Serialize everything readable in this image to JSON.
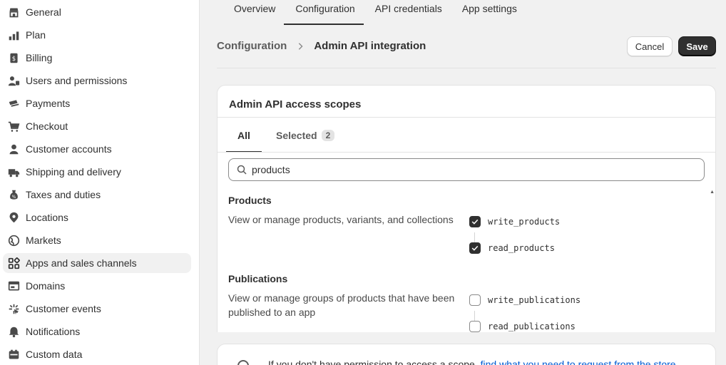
{
  "sidebar": {
    "items": [
      {
        "label": "General",
        "icon": "store-icon"
      },
      {
        "label": "Plan",
        "icon": "plan-icon"
      },
      {
        "label": "Billing",
        "icon": "billing-icon"
      },
      {
        "label": "Users and permissions",
        "icon": "users-icon"
      },
      {
        "label": "Payments",
        "icon": "payments-icon"
      },
      {
        "label": "Checkout",
        "icon": "cart-icon"
      },
      {
        "label": "Customer accounts",
        "icon": "person-icon"
      },
      {
        "label": "Shipping and delivery",
        "icon": "truck-icon"
      },
      {
        "label": "Taxes and duties",
        "icon": "tax-icon"
      },
      {
        "label": "Locations",
        "icon": "location-pin-icon"
      },
      {
        "label": "Markets",
        "icon": "globe-icon"
      },
      {
        "label": "Apps and sales channels",
        "icon": "apps-icon",
        "active": true
      },
      {
        "label": "Domains",
        "icon": "domains-icon"
      },
      {
        "label": "Customer events",
        "icon": "sparkle-icon"
      },
      {
        "label": "Notifications",
        "icon": "bell-icon"
      },
      {
        "label": "Custom data",
        "icon": "custom-data-icon"
      }
    ]
  },
  "tabs": [
    {
      "label": "Overview"
    },
    {
      "label": "Configuration",
      "active": true
    },
    {
      "label": "API credentials"
    },
    {
      "label": "App settings"
    }
  ],
  "breadcrumb": {
    "parent": "Configuration",
    "current": "Admin API integration"
  },
  "actions": {
    "cancel": "Cancel",
    "save": "Save"
  },
  "card": {
    "title": "Admin API access scopes",
    "tab_all": "All",
    "tab_selected": "Selected",
    "selected_count": "2",
    "search": {
      "value": "products"
    },
    "groups": [
      {
        "title": "Products",
        "description": "View or manage products, variants, and collections",
        "scopes": [
          {
            "label": "write_products",
            "checked": true
          },
          {
            "label": "read_products",
            "checked": true
          }
        ]
      },
      {
        "title": "Publications",
        "description": "View or manage groups of products that have been published to an app",
        "scopes": [
          {
            "label": "write_publications",
            "checked": false
          },
          {
            "label": "read_publications",
            "checked": false
          }
        ]
      }
    ]
  },
  "info": {
    "text": "If you don't have permission to access a scope,",
    "link": "find what you need to request from the store"
  },
  "colors": {
    "primary_button": "#303030",
    "link": "#005bd3",
    "page_bg": "#f1f1f1"
  }
}
